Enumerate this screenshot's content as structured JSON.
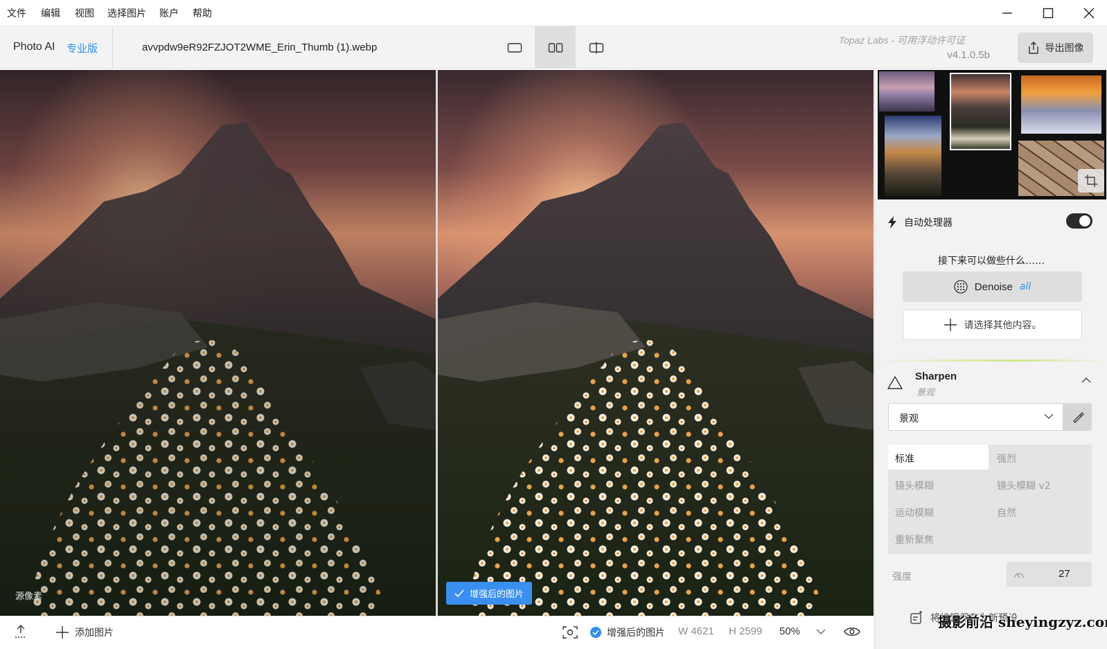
{
  "menu": [
    "文件",
    "编辑",
    "视图",
    "选择图片",
    "账户",
    "帮助"
  ],
  "brand": {
    "name": "Photo AI",
    "edition": "专业版"
  },
  "file": {
    "name": "avvpdw9eR92FZJOT2WME_Erin_Thumb (1).webp"
  },
  "license": {
    "text": "Topaz Labs - 可用浮动许可证",
    "version": "v4.1.0.5b"
  },
  "toolbar": {
    "export_label": "导出图像",
    "active_view": "side-by-side"
  },
  "panes": {
    "original_label": "源像素",
    "enhanced_label": "增强后的图片"
  },
  "bottom": {
    "add_label": "添加图片",
    "preview_label": "增强后的图片",
    "width": "W 4621",
    "height": "H 2599",
    "zoom": "50%"
  },
  "panel": {
    "autopilot_label": "自动处理器",
    "autopilot_on": true,
    "next_title": "接下来可以做些什么……",
    "denoise_label": "Denoise",
    "denoise_mode": "all",
    "select_other_label": "请选择其他内容。",
    "sharpen": {
      "title": "Sharpen",
      "subtitle": "景观",
      "selected_model": "景观",
      "models": [
        "标准",
        "强烈",
        "镜头模糊",
        "镜头模糊 v2",
        "运动模糊",
        "自然",
        "重新聚焦"
      ],
      "active_model": "标准",
      "strength_label": "强度",
      "strength_value": "27"
    },
    "save_preset_label": "将编辑保存为新预设"
  },
  "watermark": "摄影前沿 sheyingzyz.com",
  "colors": {
    "accent": "#2d8cf0",
    "badge": "#3b8ff0",
    "toggle": "#2b2b2b"
  }
}
